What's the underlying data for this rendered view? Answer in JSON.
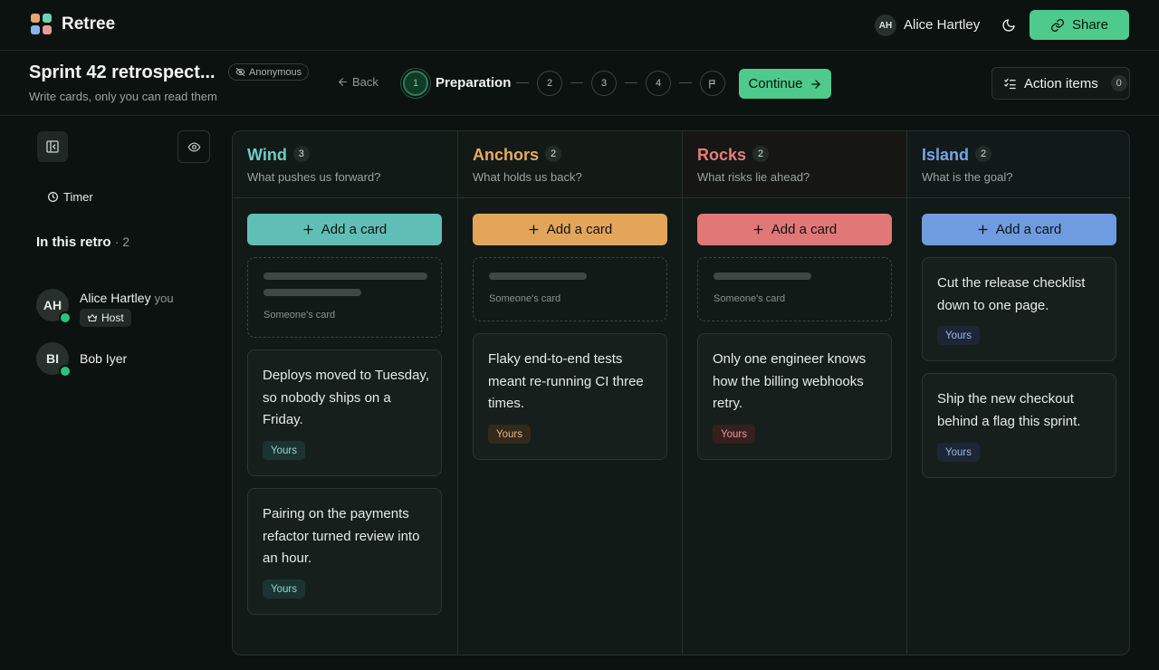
{
  "app": {
    "brand": "Retree",
    "user_initials": "AH",
    "user_name": "Alice Hartley",
    "share_label": "Share",
    "logo_colors": [
      "#e8a66b",
      "#6ad4b4",
      "#8ab4ee",
      "#e89a9a"
    ],
    "icons": {
      "theme": "moon-icon",
      "share": "link-icon"
    }
  },
  "header": {
    "title": "Sprint 42 retrospect...",
    "anonymous_label": "Anonymous",
    "subtitle": "Write cards, only you can read them",
    "back_label": "Back",
    "steps": [
      "1",
      "2",
      "3",
      "4"
    ],
    "active_step": 1,
    "active_step_label": "Preparation",
    "continue_label": "Continue",
    "action_items_label": "Action items",
    "action_items_count": "0"
  },
  "sidebar": {
    "timer_label": "Timer",
    "in_retro_label": "In this retro",
    "in_retro_count": "· 2",
    "participants": [
      {
        "initials": "AH",
        "name": "Alice Hartley",
        "you": "you",
        "badge": "Host",
        "online": true
      },
      {
        "initials": "BI",
        "name": "Bob Iyer",
        "online": true
      }
    ]
  },
  "board": {
    "add_card_label": "Add a card",
    "ghost_label": "Someone's card",
    "yours_label": "Yours",
    "columns": [
      {
        "title": "Wind",
        "count": "3",
        "subtitle": "What pushes us forward?",
        "color": "#5fbfb7",
        "text_color": "#6ecdc3",
        "badge_bg": "#1c3431",
        "badge_fg": "#8fd8cf",
        "cards": [
          "Deploys moved to Tuesday, so nobody ships on a Friday.",
          "Pairing on the payments refactor turned review into an hour."
        ]
      },
      {
        "title": "Anchors",
        "count": "2",
        "subtitle": "What holds us back?",
        "color": "#e2a55a",
        "text_color": "#e7ab63",
        "badge_bg": "#33291c",
        "badge_fg": "#e7b57a",
        "cards": [
          "Flaky end-to-end tests meant re-running CI three times."
        ]
      },
      {
        "title": "Rocks",
        "count": "2",
        "subtitle": "What risks lie ahead?",
        "color": "#e27777",
        "text_color": "#e77c7c",
        "badge_bg": "#35201f",
        "badge_fg": "#e99692",
        "cards": [
          "Only one engineer knows how the billing webhooks retry."
        ]
      },
      {
        "title": "Island",
        "count": "2",
        "subtitle": "What is the goal?",
        "color": "#6f9be0",
        "text_color": "#78a3e6",
        "badge_bg": "#1c2636",
        "badge_fg": "#9bb9e8",
        "cards": [
          "Cut the release checklist down to one page.",
          "Ship the new checkout behind a flag this sprint."
        ]
      }
    ]
  }
}
